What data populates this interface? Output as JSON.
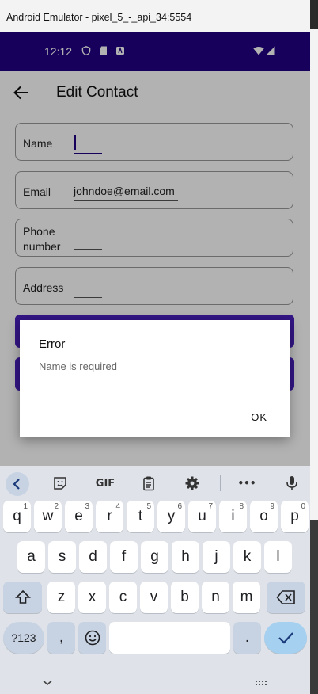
{
  "window": {
    "title": "Android Emulator - pixel_5_-_api_34:5554"
  },
  "status_bar": {
    "time": "12:12"
  },
  "app_bar": {
    "title": "Edit Contact"
  },
  "form": {
    "name": {
      "label": "Name",
      "value": ""
    },
    "email": {
      "label": "Email",
      "value": "johndoe@email.com"
    },
    "phone": {
      "label_line1": "Phone",
      "label_line2": "number",
      "value": ""
    },
    "address": {
      "label": "Address",
      "value": ""
    }
  },
  "dialog": {
    "title": "Error",
    "message": "Name is required",
    "ok_label": "OK"
  },
  "keyboard": {
    "toolbar": {
      "gif_label": "GIF",
      "more_label": "•••"
    },
    "row1": [
      {
        "k": "q",
        "sup": "1"
      },
      {
        "k": "w",
        "sup": "2"
      },
      {
        "k": "e",
        "sup": "3"
      },
      {
        "k": "r",
        "sup": "4"
      },
      {
        "k": "t",
        "sup": "5"
      },
      {
        "k": "y",
        "sup": "6"
      },
      {
        "k": "u",
        "sup": "7"
      },
      {
        "k": "i",
        "sup": "8"
      },
      {
        "k": "o",
        "sup": "9"
      },
      {
        "k": "p",
        "sup": "0"
      }
    ],
    "row2": [
      "a",
      "s",
      "d",
      "f",
      "g",
      "h",
      "j",
      "k",
      "l"
    ],
    "row3": [
      "z",
      "x",
      "c",
      "v",
      "b",
      "n",
      "m"
    ],
    "sym_label": "?123",
    "comma_label": ",",
    "period_label": ".",
    "colors": {
      "background": "#dfe3e9",
      "function_key": "#c7d3e3",
      "enter_key": "#a6d0ef"
    }
  },
  "colors": {
    "status_bar": "#210083",
    "button": "#4a1fbf"
  }
}
